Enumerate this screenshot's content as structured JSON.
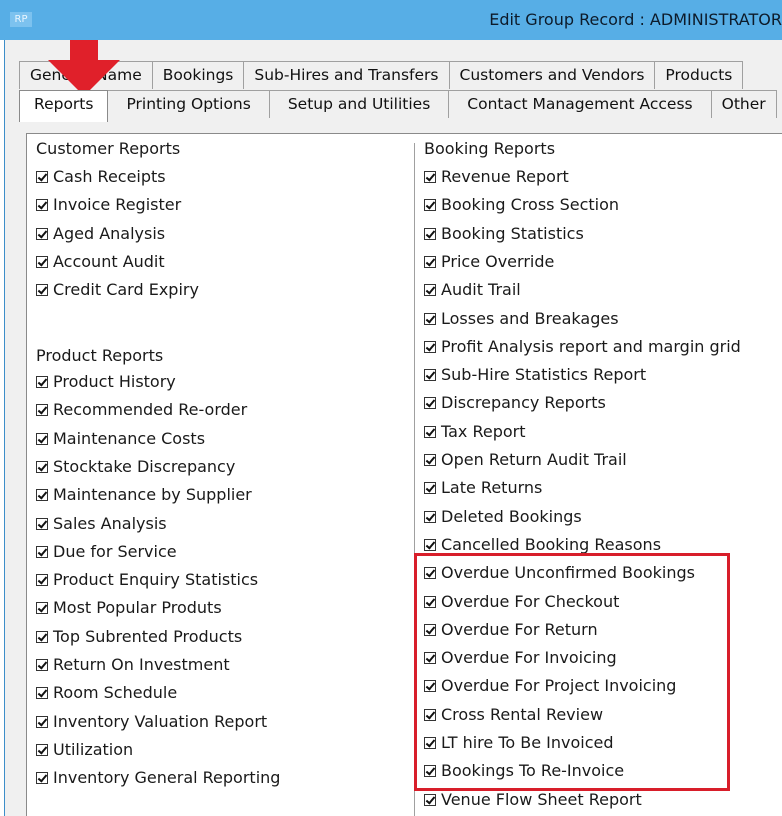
{
  "window": {
    "icon_text": "RP",
    "title": "Edit Group Record : ADMINISTRATOR"
  },
  "tabs_back": [
    "General Name",
    "Bookings",
    "Sub-Hires and Transfers",
    "Customers and Vendors",
    "Products"
  ],
  "tabs_front": [
    "Reports",
    "Printing Options",
    "Setup and Utilities",
    "Contact Management Access",
    "Other"
  ],
  "left": {
    "customer_title": "Customer Reports",
    "customer_items": [
      "Cash Receipts",
      "Invoice Register",
      "Aged Analysis",
      "Account Audit",
      "Credit Card Expiry"
    ],
    "product_title": "Product Reports",
    "product_items": [
      "Product History",
      "Recommended Re-order",
      "Maintenance Costs",
      "Stocktake Discrepancy",
      "Maintenance by Supplier",
      "Sales Analysis",
      "Due for Service",
      "Product Enquiry Statistics",
      "Most Popular Produts",
      "Top Subrented Products",
      "Return On Investment",
      "Room Schedule",
      "Inventory Valuation Report",
      "Utilization",
      "Inventory General Reporting"
    ]
  },
  "right": {
    "booking_title": "Booking Reports",
    "booking_items": [
      "Revenue Report",
      "Booking Cross Section",
      "Booking Statistics",
      "Price Override",
      "Audit Trail",
      "Losses and Breakages",
      "Profit Analysis report and margin grid",
      "Sub-Hire Statistics Report",
      "Discrepancy Reports",
      "Tax Report",
      "Open Return Audit Trail",
      "Late Returns",
      "Deleted Bookings",
      "Cancelled Booking Reasons",
      "Overdue Unconfirmed Bookings",
      "Overdue For Checkout",
      "Overdue For Return",
      "Overdue For Invoicing",
      "Overdue For Project Invoicing",
      "Cross Rental Review",
      "LT hire To Be Invoiced",
      "Bookings To Re-Invoice",
      "Venue Flow Sheet Report"
    ]
  },
  "colors": {
    "titlebar": "#57aee6",
    "highlight": "#d81e2a",
    "arrow": "#e0202a"
  }
}
